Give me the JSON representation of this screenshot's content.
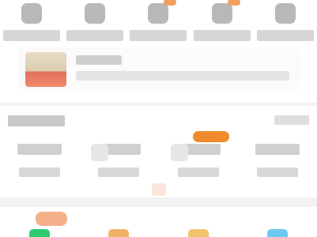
{
  "quick": {
    "items": [
      {
        "label": "",
        "badge": false
      },
      {
        "label": "",
        "badge": false
      },
      {
        "label": "",
        "badge": true
      },
      {
        "label": "",
        "badge": true
      },
      {
        "label": "",
        "badge": false
      }
    ]
  },
  "banner": {
    "title": "",
    "description": ""
  },
  "section": {
    "title": "",
    "more": "",
    "tools": [
      {
        "name": "",
        "sub": "",
        "hot": false
      },
      {
        "name": "",
        "sub": "",
        "hot": false
      },
      {
        "name": "",
        "sub": "",
        "hot": true
      },
      {
        "name": "",
        "sub": "",
        "hot": false
      }
    ]
  },
  "bottom": {
    "items": [
      {
        "color": "#2ecc71",
        "badge": true
      },
      {
        "color": "#f2b26a",
        "badge": false
      },
      {
        "color": "#f2c36a",
        "badge": false
      },
      {
        "color": "#6cc9f2",
        "badge": false
      }
    ]
  },
  "colors": {
    "accent": "#f08a2c",
    "background": "#f2f2f2"
  }
}
